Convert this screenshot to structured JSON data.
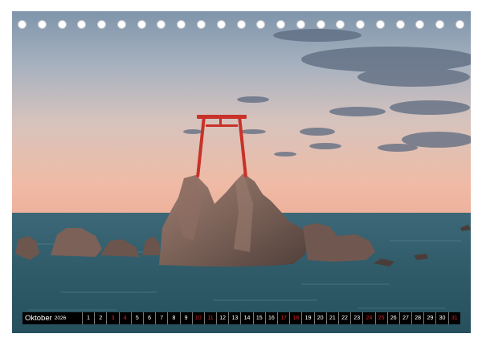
{
  "calendar": {
    "month": "Oktober",
    "year": "2026",
    "days": [
      {
        "n": "1",
        "weekend": false
      },
      {
        "n": "2",
        "weekend": false
      },
      {
        "n": "3",
        "weekend": true
      },
      {
        "n": "4",
        "weekend": true
      },
      {
        "n": "5",
        "weekend": false
      },
      {
        "n": "6",
        "weekend": false
      },
      {
        "n": "7",
        "weekend": false
      },
      {
        "n": "8",
        "weekend": false
      },
      {
        "n": "9",
        "weekend": false
      },
      {
        "n": "10",
        "weekend": true
      },
      {
        "n": "11",
        "weekend": true
      },
      {
        "n": "12",
        "weekend": false
      },
      {
        "n": "13",
        "weekend": false
      },
      {
        "n": "14",
        "weekend": false
      },
      {
        "n": "15",
        "weekend": false
      },
      {
        "n": "16",
        "weekend": false
      },
      {
        "n": "17",
        "weekend": true
      },
      {
        "n": "18",
        "weekend": true
      },
      {
        "n": "19",
        "weekend": false
      },
      {
        "n": "20",
        "weekend": false
      },
      {
        "n": "21",
        "weekend": false
      },
      {
        "n": "22",
        "weekend": false
      },
      {
        "n": "23",
        "weekend": false
      },
      {
        "n": "24",
        "weekend": true
      },
      {
        "n": "25",
        "weekend": true
      },
      {
        "n": "26",
        "weekend": false
      },
      {
        "n": "27",
        "weekend": false
      },
      {
        "n": "28",
        "weekend": false
      },
      {
        "n": "29",
        "weekend": false
      },
      {
        "n": "30",
        "weekend": false
      },
      {
        "n": "31",
        "weekend": true
      }
    ]
  },
  "binding": {
    "hole_count": 23
  },
  "colors": {
    "sky_top": "#8ea2b6",
    "sky_mid": "#d7c3bd",
    "sky_horizon": "#eeb6a2",
    "sea": "#2f5a68",
    "rock": "#7a6157",
    "torii": "#c83228",
    "weekend_day": "#d0262a",
    "calendar_bar": "#000000"
  }
}
